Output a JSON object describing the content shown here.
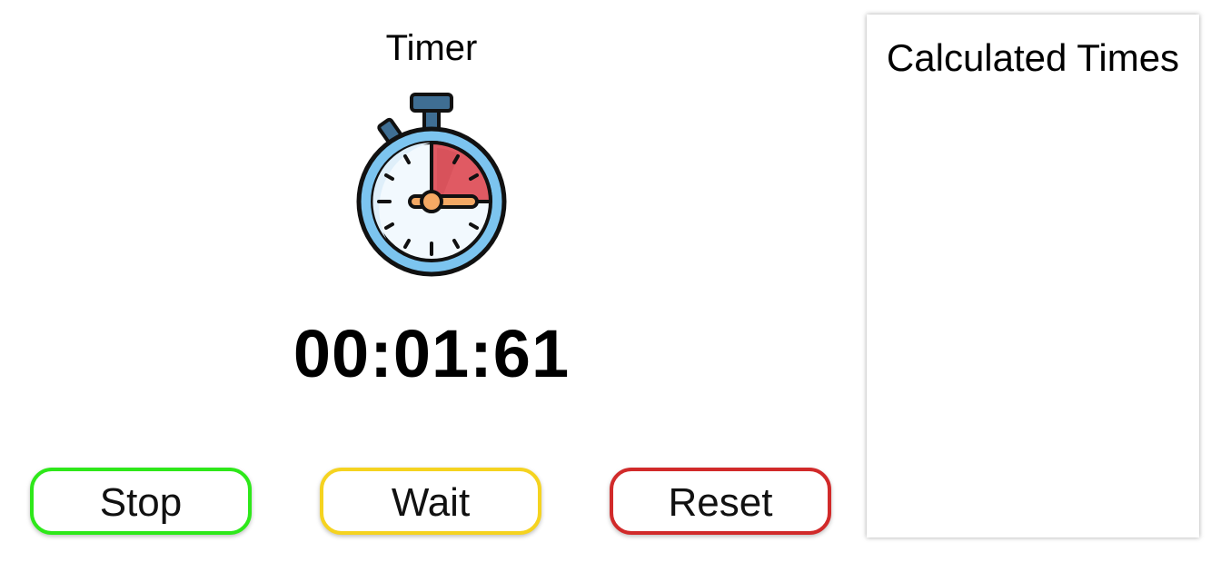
{
  "timer": {
    "title": "Timer",
    "display": "00:01:61",
    "icon": "stopwatch-icon"
  },
  "controls": {
    "stop_label": "Stop",
    "wait_label": "Wait",
    "reset_label": "Reset"
  },
  "calculated_times": {
    "title": "Calculated Times",
    "items": []
  },
  "colors": {
    "stop_border": "#2ee81a",
    "wait_border": "#f5d320",
    "reset_border": "#d12a2a",
    "stopwatch_face": "#eaf6fe",
    "stopwatch_ring": "#7cc4ef",
    "stopwatch_elapsed": "#e05a63",
    "stopwatch_hand": "#f5a964",
    "stopwatch_crown": "#3f6e93"
  }
}
